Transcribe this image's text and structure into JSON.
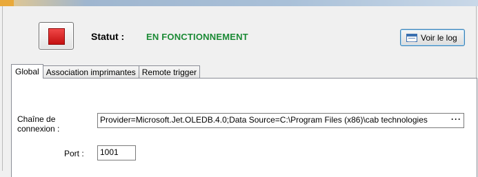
{
  "header": {
    "status_label": "Statut :",
    "status_value": "EN FONCTIONNEMENT",
    "status_color": "#1b8a35",
    "stop_icon": "stop-square-icon",
    "log_button_label": "Voir le log",
    "log_icon": "log-window-icon"
  },
  "tabs": [
    {
      "label": "Global",
      "active": true
    },
    {
      "label": "Association imprimantes",
      "active": false
    },
    {
      "label": "Remote trigger",
      "active": false
    }
  ],
  "global": {
    "connection_label_line1": "Chaîne de",
    "connection_label_line2": "connexion :",
    "connection_value": "Provider=Microsoft.Jet.OLEDB.4.0;Data Source=C:\\Program Files (x86)\\cab technologies",
    "connection_more": "···",
    "port_label": "Port :",
    "port_value": "1001"
  }
}
